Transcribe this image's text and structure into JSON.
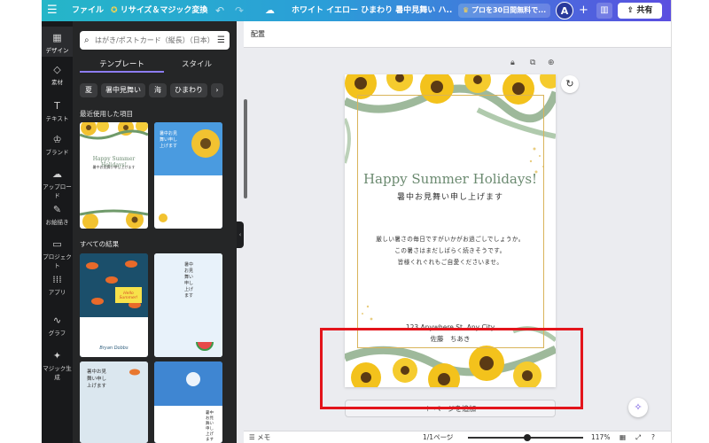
{
  "topbar": {
    "menu_icon": "hamburger-icon",
    "file": "ファイル",
    "resize": "リサイズ＆マジック変換",
    "undo_icon": "undo-icon",
    "redo_icon": "redo-icon",
    "cloud_icon": "cloud-save-icon",
    "title": "ホワイト イエロー ひまわり 暑中見舞い ハ...",
    "pro": "プロを30日間無料で...",
    "avatar": "A",
    "plus": "+",
    "chart_icon": "analytics-icon",
    "share": "共有"
  },
  "rail": [
    {
      "label": "デザイン",
      "icon": "layout-icon"
    },
    {
      "label": "素材",
      "icon": "shapes-icon"
    },
    {
      "label": "テキスト",
      "icon": "text-icon"
    },
    {
      "label": "ブランド",
      "icon": "brand-icon"
    },
    {
      "label": "アップロード",
      "icon": "upload-icon"
    },
    {
      "label": "お絵描き",
      "icon": "draw-icon"
    },
    {
      "label": "プロジェクト",
      "icon": "folder-icon"
    },
    {
      "label": "アプリ",
      "icon": "apps-icon"
    },
    {
      "label": "グラフ",
      "icon": "graph-icon"
    },
    {
      "label": "マジック生成",
      "icon": "magic-icon"
    }
  ],
  "panel": {
    "search_placeholder": "はがき/ポストカード（縦長）（日本）",
    "tabs": [
      "テンプレート",
      "スタイル"
    ],
    "chips": [
      "夏",
      "暑中見舞い",
      "海",
      "ひまわり",
      "›"
    ],
    "recent_label": "最近使用した項目",
    "all_label": "すべての結果",
    "thumb_texts": {
      "t1_title": "Happy Summer Holidays!",
      "t1_sub": "暑中お見舞い申し上げます",
      "t2_text": "暑中お見舞い申し上げます",
      "t3_badge": "Hello Summer!",
      "t3_name": "Bryan Dobbs",
      "t4_text": "暑中お見舞い申し上げます",
      "t5_text": "暑中お見舞い申し上げます",
      "t6_text": "暑中お見舞い申し上げます"
    }
  },
  "canvas": {
    "toolbar_label": "配置",
    "page_title": "Happy Summer Holidays!",
    "page_subtitle": "暑中お見舞い申し上げます",
    "body_lines": [
      "厳しい暑さの毎日ですがいかがお過ごしでしょうか。",
      "この暑さはまだしばらく続きそうです。",
      "皆様くれぐれもご自愛くださいませ。"
    ],
    "address": "123 Anywhere St. Any City",
    "name": "佐藤　ちあき",
    "add_page": "＋ ページを追加",
    "page_icons": [
      "lock-icon",
      "duplicate-icon",
      "add-page-icon"
    ]
  },
  "bottombar": {
    "memo": "メモ",
    "up_icon": "chevron-up-icon",
    "page": "1/1ページ",
    "zoom": "117%",
    "zoom_level": 0.49,
    "grid_icon": "grid-icon",
    "fullscreen_icon": "fullscreen-icon",
    "help": "?"
  },
  "colors": {
    "accent": "#8c7cf0",
    "topbar_start": "#25b6c8",
    "topbar_end": "#5b4ee0",
    "highlight": "#e3141b",
    "panel_bg": "#252627",
    "rail_bg": "#18191b"
  }
}
